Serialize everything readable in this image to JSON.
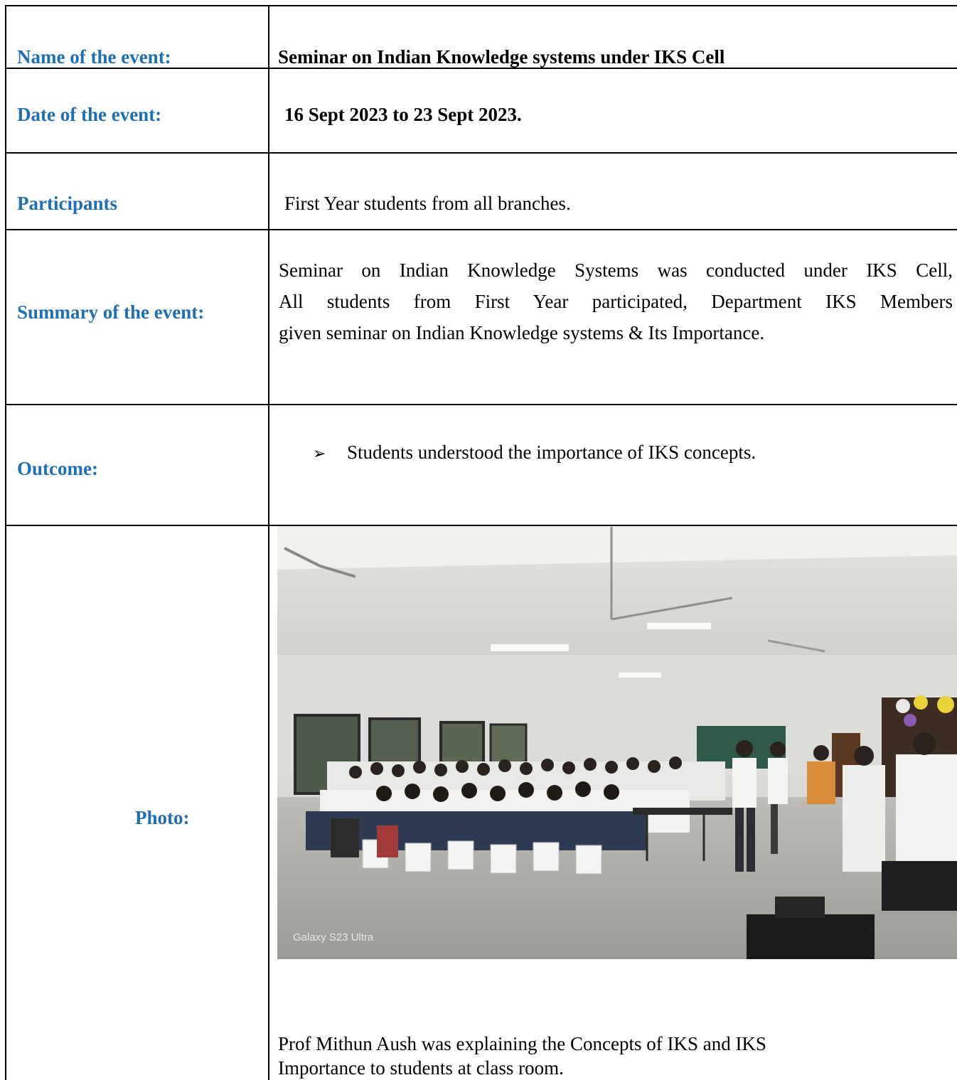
{
  "rows": {
    "name": {
      "label": "Name of the event:",
      "value": "Seminar on Indian Knowledge systems under IKS Cell"
    },
    "date": {
      "label": "Date of the event:",
      "value": "16 Sept 2023 to 23 Sept 2023."
    },
    "participants": {
      "label": "Participants",
      "value": "First Year students from all branches."
    },
    "summary": {
      "label": "Summary of the event:",
      "lines": [
        "Seminar on Indian Knowledge Systems  was conducted under IKS Cell,",
        "All students from First Year participated,  Department IKS Members",
        "given seminar on Indian Knowledge systems & Its Importance."
      ]
    },
    "outcome": {
      "label": "Outcome:",
      "bullets": [
        "Students understood the importance of IKS concepts."
      ]
    },
    "photo": {
      "label": "Photo:",
      "watermark": "Galaxy S23 Ultra",
      "caption_lines": [
        "Prof Mithun Aush was explaining the Concepts of IKS and IKS",
        "Importance to students at class room."
      ]
    }
  },
  "colors": {
    "label": "#1f6fb5",
    "border": "#000000"
  }
}
